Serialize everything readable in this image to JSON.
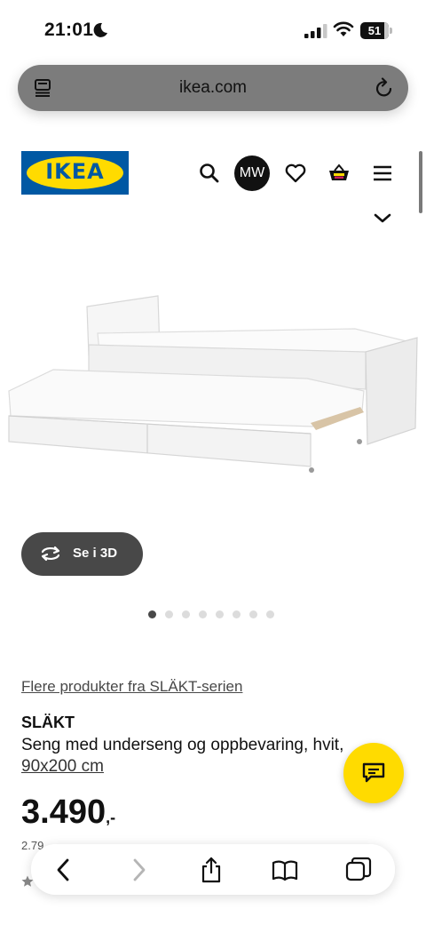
{
  "status_bar": {
    "time": "21:01",
    "battery": "51"
  },
  "browser": {
    "url": "ikea.com"
  },
  "header": {
    "logo_text": "IKEA",
    "avatar_initials": "MW"
  },
  "gallery": {
    "view_3d_label": "Se i 3D",
    "image_count": 8,
    "active_index": 0
  },
  "product": {
    "series_link": "Flere produkter fra SLÄKT-serien",
    "name": "SLÄKT",
    "description": "Seng med underseng og oppbevaring, hvit,",
    "size": "90x200 cm",
    "price": "3.490",
    "price_suffix": ",-",
    "subline": "2.79"
  },
  "colors": {
    "ikea_blue": "#0058a3",
    "ikea_yellow": "#ffdb00",
    "dark_button": "#484848"
  },
  "icons": [
    "moon-icon",
    "signal-icon",
    "wifi-icon",
    "battery-icon",
    "reader-icon",
    "reload-icon",
    "search-icon",
    "heart-icon",
    "cart-icon",
    "menu-icon",
    "chevron-down-icon",
    "rotate-3d-icon",
    "chat-icon",
    "back-icon",
    "forward-icon",
    "share-icon",
    "bookmarks-icon",
    "tabs-icon",
    "star-icon"
  ]
}
